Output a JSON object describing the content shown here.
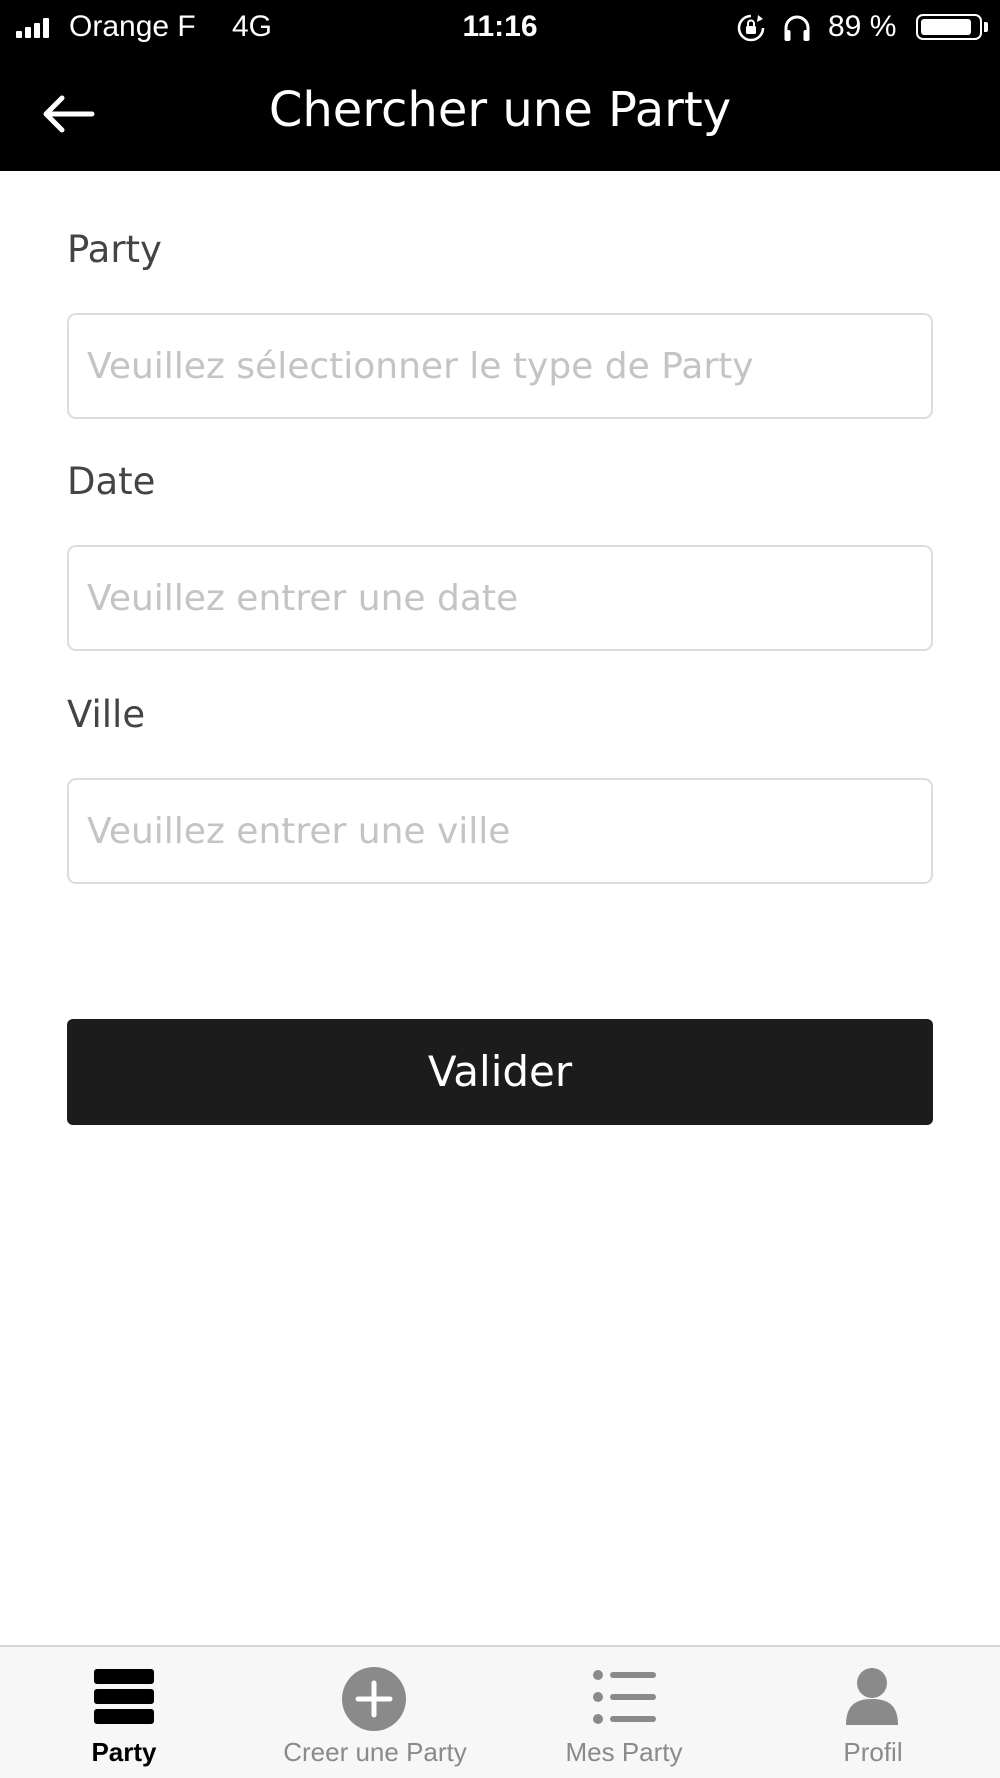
{
  "status_bar": {
    "carrier": "Orange F",
    "network": "4G",
    "time": "11:16",
    "battery_text": "89 %",
    "battery_level": 0.89,
    "icons": [
      "signal-icon",
      "rotation-lock-icon",
      "headphones-icon",
      "battery-icon"
    ]
  },
  "header": {
    "back_icon": "arrow-left-icon",
    "title": "Chercher une Party",
    "background": "#000000"
  },
  "form": {
    "party": {
      "label": "Party",
      "value": "",
      "placeholder": "Veuillez sélectionner le type de Party"
    },
    "date": {
      "label": "Date",
      "value": "",
      "placeholder": "Veuillez entrer une date"
    },
    "ville": {
      "label": "Ville",
      "value": "",
      "placeholder": "Veuillez entrer une ville"
    },
    "submit_label": "Valider",
    "submit_color": "#1c1c1c"
  },
  "tab_bar": {
    "active_tab": "party",
    "active_color": "#000000",
    "inactive_color": "#8a8a8a",
    "tabs": [
      {
        "id": "party",
        "label": "Party",
        "icon": "stack-icon"
      },
      {
        "id": "create",
        "label": "Creer une Party",
        "icon": "plus-circle-icon"
      },
      {
        "id": "mine",
        "label": "Mes Party",
        "icon": "list-icon"
      },
      {
        "id": "profil",
        "label": "Profil",
        "icon": "person-icon"
      }
    ]
  }
}
